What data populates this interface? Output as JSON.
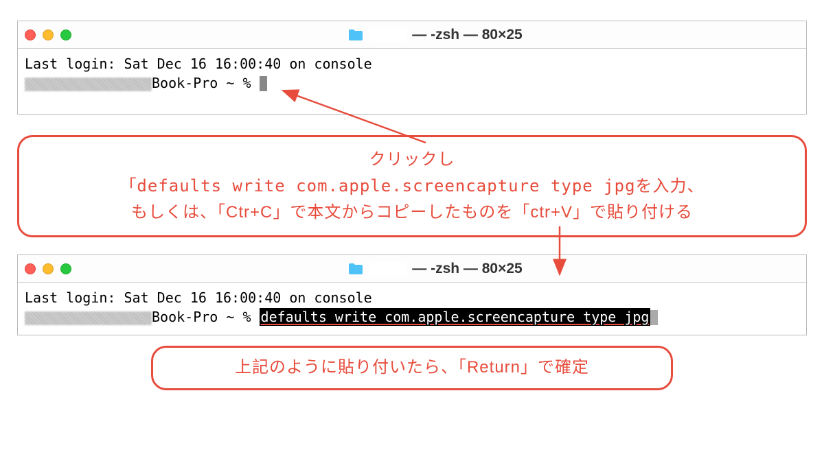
{
  "window": {
    "title_suffix": "— -zsh — 80×25"
  },
  "terminal1": {
    "last_login": "Last login: Sat Dec 16 16:00:40 on console",
    "prompt_suffix": "Book-Pro ~ % "
  },
  "terminal2": {
    "last_login": "Last login: Sat Dec 16 16:00:40 on console",
    "prompt_suffix": "Book-Pro ~ % ",
    "command": "defaults write com.apple.screencapture type jpg"
  },
  "annotation1": {
    "line1": "クリックし",
    "line2": "「defaults write com.apple.screencapture type jpgを入力、",
    "line3": "もしくは、「Ctr+C」で本文からコピーしたものを「ctr+V」で貼り付ける"
  },
  "annotation2": {
    "text": "上記のように貼り付いたら、「Return」で確定"
  }
}
